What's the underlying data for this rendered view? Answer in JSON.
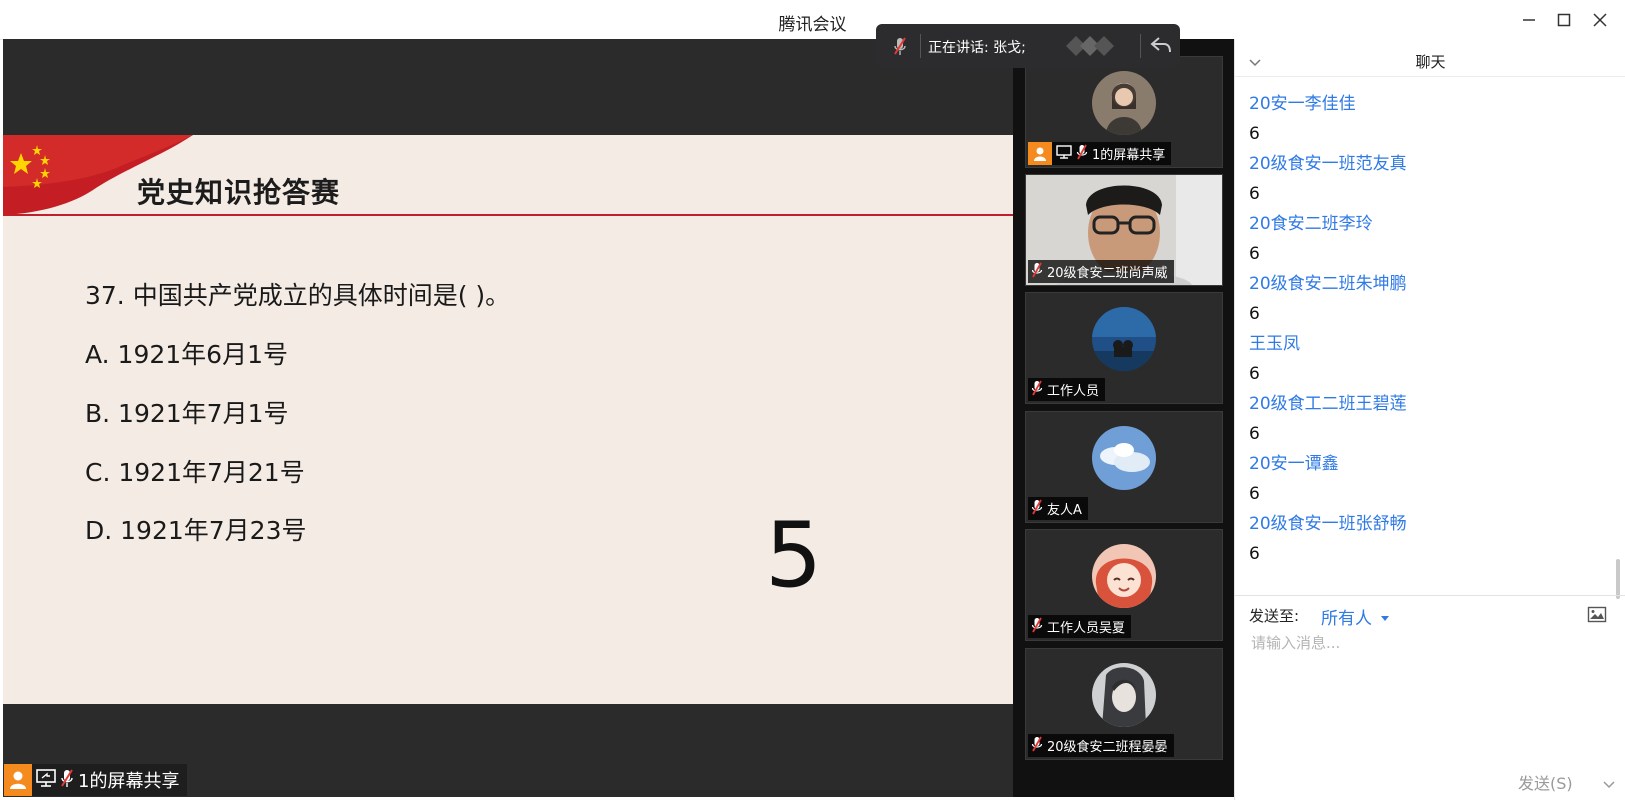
{
  "app": {
    "title": "腾讯会议"
  },
  "speaking": {
    "label": "正在讲话: 张戈;"
  },
  "slide": {
    "title": "党史知识抢答赛",
    "question": "37. 中国共产党成立的具体时间是(              )。",
    "options": [
      "A. 1921年6月1号",
      "B. 1921年7月1号",
      "C. 1921年7月21号",
      "D. 1921年7月23号"
    ],
    "countdown": "5"
  },
  "share_badge": {
    "label": "1的屏幕共享"
  },
  "gallery": {
    "tiles": [
      {
        "name": "1的屏幕共享"
      },
      {
        "name": "20级食安二班尚声威"
      },
      {
        "name": "工作人员"
      },
      {
        "name": "友人A"
      },
      {
        "name": "工作人员吴夏"
      },
      {
        "name": "20级食安二班程晏晏"
      }
    ]
  },
  "chat": {
    "title": "聊天",
    "messages": [
      {
        "sender": "20安一李佳佳",
        "text": "6"
      },
      {
        "sender": "20级食安一班范友真",
        "text": "6"
      },
      {
        "sender": "20食安二班李玲",
        "text": "6"
      },
      {
        "sender": "20级食安二班朱坤鹏",
        "text": "6"
      },
      {
        "sender": "王玉凤",
        "text": "6"
      },
      {
        "sender": "20级食工二班王碧莲",
        "text": "6"
      },
      {
        "sender": "20安一谭鑫",
        "text": "6"
      },
      {
        "sender": "20级食安一班张舒畅",
        "text": "6"
      }
    ],
    "send_to_label": "发送至:",
    "send_to_value": "所有人",
    "input_placeholder": "请输入消息...",
    "send_label": "发送(S)"
  },
  "colors": {
    "accent": "#2f7ae5",
    "share_orange": "#f58a1f",
    "slide_red": "#c0202a"
  }
}
